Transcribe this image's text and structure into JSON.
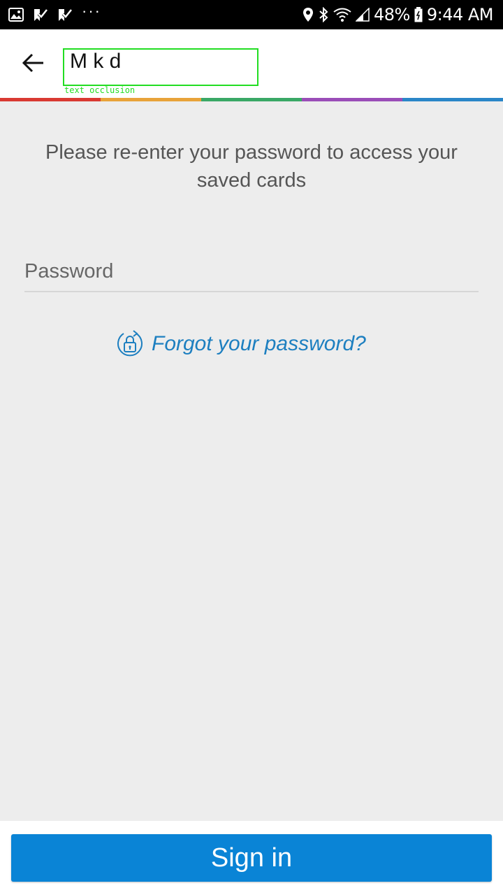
{
  "status_bar": {
    "battery_percent": "48%",
    "time": "9:44 AM",
    "left_icons": [
      "gallery-icon",
      "check-flag-icon",
      "check-flag-icon",
      "more-dots-icon"
    ],
    "right_icons": [
      "location-icon",
      "bluetooth-icon",
      "wifi-icon",
      "signal-icon",
      "battery-icon"
    ]
  },
  "app_bar": {
    "back_icon": "arrow-left-icon",
    "title": "M                 k  d",
    "occlusion_label": "text occlusion"
  },
  "stripe_colors": [
    "#d93a32",
    "#e8a33a",
    "#3aa866",
    "#9a4db8",
    "#2a86c8"
  ],
  "main": {
    "instruction": "Please re-enter your password to access your saved cards",
    "password_placeholder": "Password",
    "password_value": "",
    "forgot_icon": "lock-refresh-icon",
    "forgot_label": "Forgot your password?"
  },
  "footer": {
    "sign_in_label": "Sign in"
  },
  "colors": {
    "accent": "#0a84d6",
    "link": "#1d7fc0",
    "background": "#ededed"
  }
}
